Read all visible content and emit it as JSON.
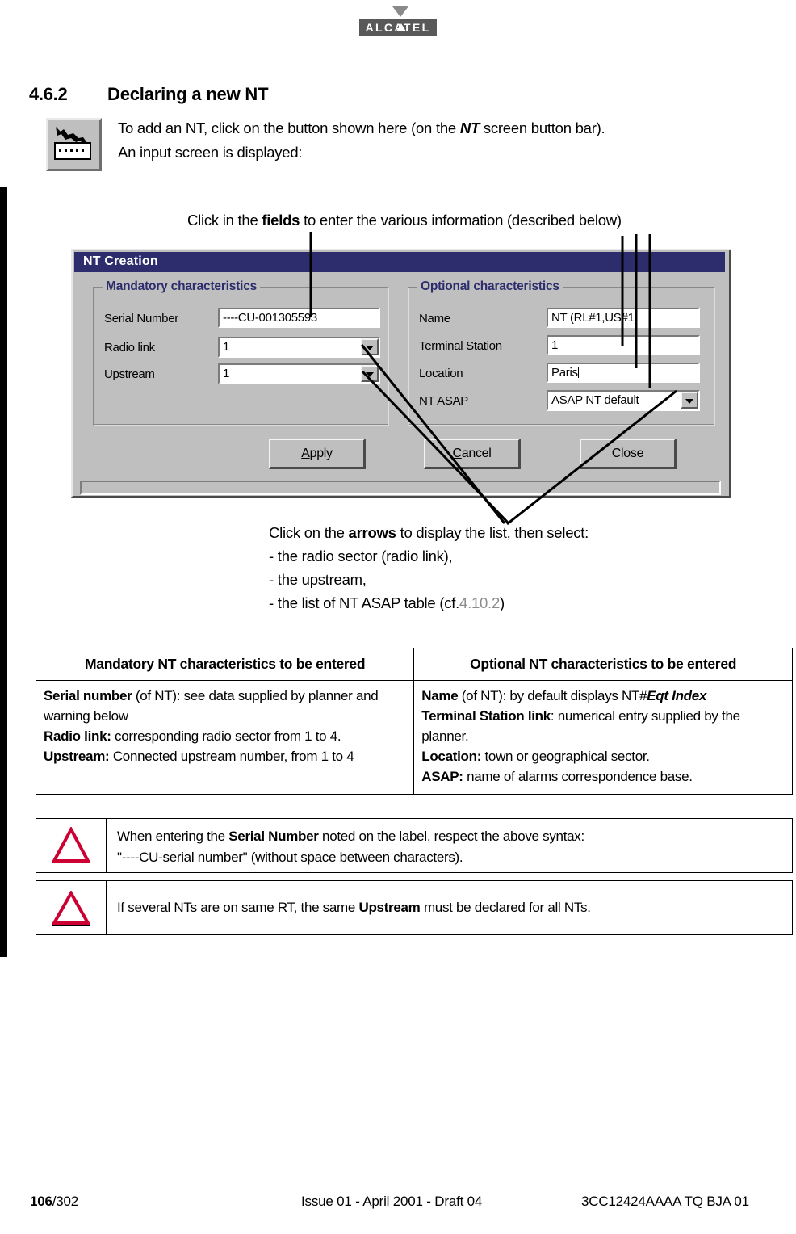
{
  "brand": {
    "logo_text": "ALCATEL",
    "logo_bg": "#595959"
  },
  "section": {
    "number": "4.6.2",
    "title": "Declaring a new NT",
    "intro_line1_a": "To add an NT, click on the button shown here (on the ",
    "intro_line1_em": "NT",
    "intro_line1_b": " screen button bar).",
    "intro_line2": "An input screen is displayed:",
    "tool_icon": "nt-add-button-icon"
  },
  "callouts": {
    "fields_a": "Click in the ",
    "fields_bold": "fields",
    "fields_b": " to enter the various information (described below)",
    "arrows_a": "Click on the ",
    "arrows_bold": "arrows",
    "arrows_b": " to display the list, then select:",
    "bullet1": "- the radio sector (radio link),",
    "bullet2": "- the upstream,",
    "bullet3_a": "- the list of NT ASAP table (cf.",
    "bullet3_ref": "4.10.2",
    "bullet3_b": ")"
  },
  "dialog": {
    "title": "NT Creation",
    "title_bg": "#2d2d6e",
    "face": "#bfbfbf",
    "mandatory_group": "Mandatory characteristics",
    "optional_group": "Optional characteristics",
    "fields": {
      "serial_number_label": "Serial Number",
      "serial_number_value": "----CU-001305593",
      "radio_link_label": "Radio link",
      "radio_link_value": "1",
      "upstream_label": "Upstream",
      "upstream_value": "1",
      "name_label": "Name",
      "name_value": "NT (RL#1,US#1)",
      "terminal_station_label": "Terminal Station",
      "terminal_station_value": "1",
      "location_label": "Location",
      "location_value": "Paris",
      "nt_asap_label": "NT ASAP",
      "nt_asap_value": "ASAP NT default"
    },
    "buttons": {
      "apply_accel": "A",
      "apply_rest": "pply",
      "cancel_accel": "C",
      "cancel_rest": "ancel",
      "close": "Close"
    }
  },
  "table": {
    "header_left": "Mandatory NT characteristics to be entered",
    "header_right": "Optional NT characteristics to be entered",
    "left_rows": [
      {
        "bold": "Serial number",
        "rest": " (of NT): see data supplied by planner and warning below"
      },
      {
        "bold": "Radio link:",
        "rest": " corresponding radio sector from 1 to 4."
      },
      {
        "bold": "Upstream:",
        "rest": " Connected upstream number, from 1 to 4"
      }
    ],
    "right_rows": [
      {
        "bold": "Name",
        "rest": " (of NT): by default displays NT#",
        "italic": "Eqt Index"
      },
      {
        "bold": "Terminal Station link",
        "rest": ": numerical entry supplied by the planner."
      },
      {
        "bold": "Location:",
        "rest": " town or geographical sector."
      },
      {
        "bold": "ASAP:",
        "rest": " name of alarms correspondence base."
      }
    ]
  },
  "warnings": [
    {
      "icon": "warning-triangle-icon",
      "color": "#cc0033",
      "line1_a": "When entering the ",
      "line1_bold": "Serial Number",
      "line1_b": " noted on the label, respect the above syntax:",
      "line2": "\"----CU-serial number\" (without space between characters)."
    },
    {
      "icon": "warning-triangle-icon",
      "color": "#cc0033",
      "line1_a": "If several NTs are on same RT, the same ",
      "line1_bold": "Upstream",
      "line1_b": " must be declared for all NTs.",
      "line2": ""
    }
  ],
  "footer": {
    "page_current": "106",
    "page_total": "/302",
    "issue": "Issue 01 - April 2001 - Draft 04",
    "reference": "3CC12424AAAA TQ BJA 01"
  }
}
